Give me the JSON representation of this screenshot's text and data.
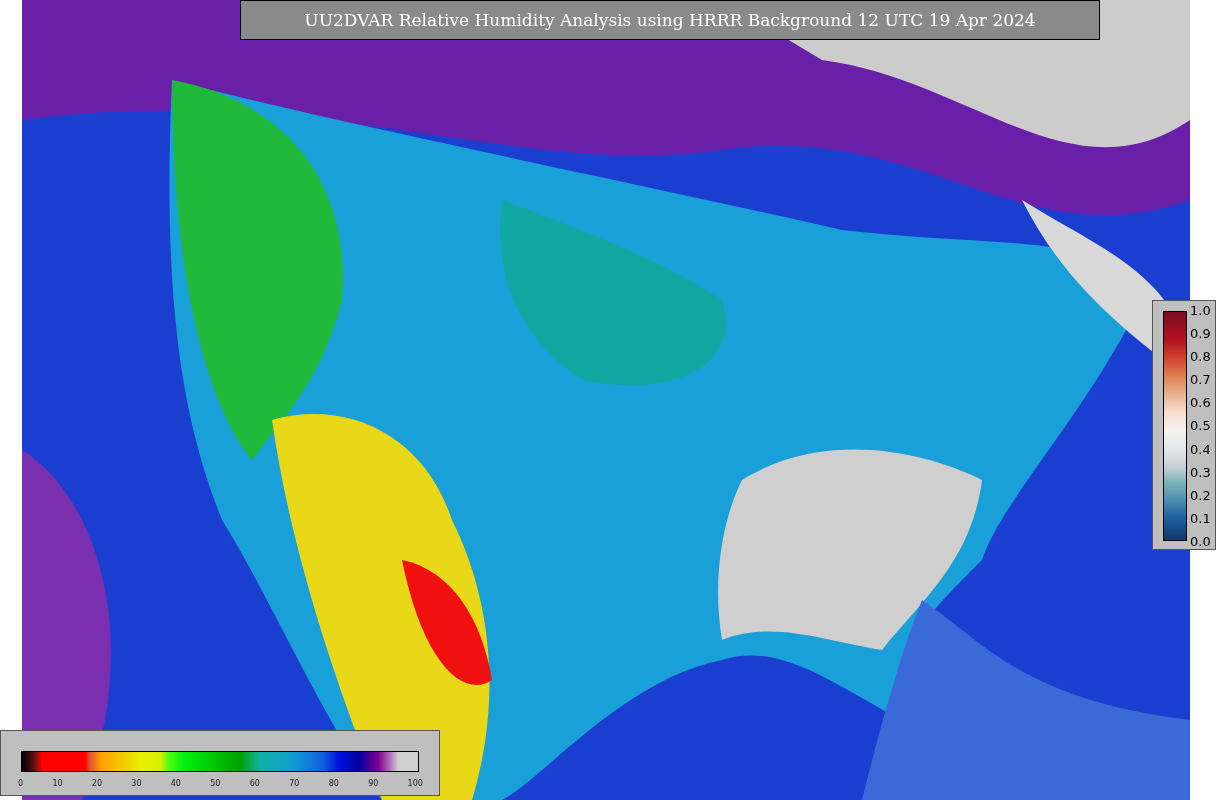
{
  "title": "UU2DVAR Relative Humidity Analysis using HRRR Background 12 UTC 19 Apr 2024",
  "humidity_colorbar": {
    "ticks": [
      "0",
      "10",
      "20",
      "30",
      "40",
      "50",
      "60",
      "70",
      "80",
      "90",
      "100"
    ]
  },
  "observation_colorbar": {
    "ticks": [
      "1.0",
      "0.9",
      "0.8",
      "0.7",
      "0.6",
      "0.5",
      "0.4",
      "0.3",
      "0.2",
      "0.1",
      "0.0"
    ]
  }
}
